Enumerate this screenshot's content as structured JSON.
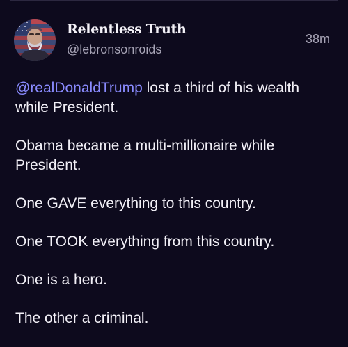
{
  "post": {
    "author_name": "Relentless Truth",
    "author_handle": "@lebronsonroids",
    "timestamp": "38m",
    "avatar_icon": "user-avatar",
    "mention": "@realDonaldTrump",
    "paragraphs": [
      " lost a third of his wealth while President.",
      "Obama became a multi-millionaire while President.",
      "One GAVE everything to this country.",
      "One TOOK everything from this country.",
      "One is a hero.",
      "The other a criminal."
    ]
  },
  "colors": {
    "background": "#0d0a1d",
    "text": "#f2f0f7",
    "muted": "#a7a4b6",
    "mention": "#8a8bff"
  }
}
